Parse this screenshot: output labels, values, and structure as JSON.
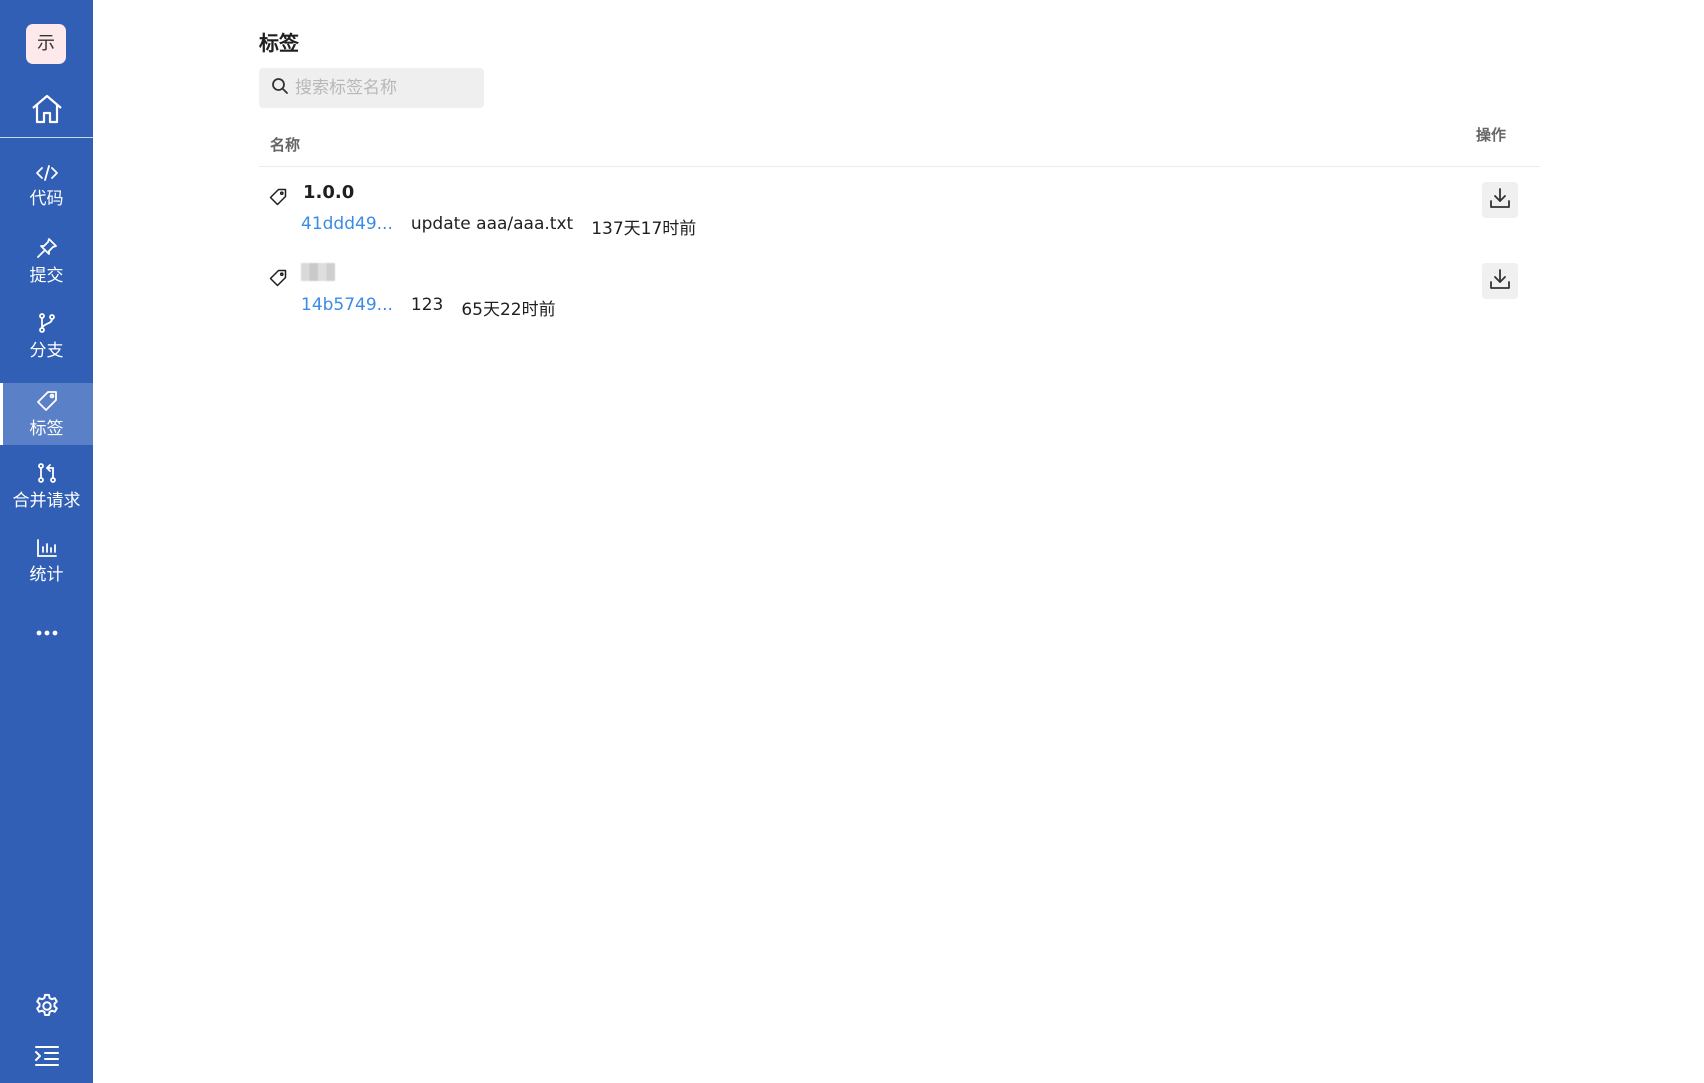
{
  "sidebar": {
    "avatar_text": "示",
    "home_icon": "home-icon",
    "items": [
      {
        "label": "代码",
        "icon": "code-icon",
        "active": false
      },
      {
        "label": "提交",
        "icon": "pin-icon",
        "active": false
      },
      {
        "label": "分支",
        "icon": "branch-icon",
        "active": false
      },
      {
        "label": "标签",
        "icon": "tag-icon",
        "active": true
      },
      {
        "label": "合并请求",
        "icon": "merge-request-icon",
        "active": false
      },
      {
        "label": "统计",
        "icon": "bar-chart-icon",
        "active": false
      }
    ],
    "more_icon": "more-icon",
    "settings_icon": "gear-icon",
    "collapse_icon": "collapse-menu-icon"
  },
  "page": {
    "title": "标签",
    "search": {
      "placeholder": "搜索标签名称",
      "value": ""
    },
    "table": {
      "columns": {
        "name": "名称",
        "actions": "操作"
      },
      "rows": [
        {
          "name": "1.0.0",
          "name_blurred": false,
          "commit": "41ddd49...",
          "message": "update aaa/aaa.txt",
          "time": "137天17时前"
        },
        {
          "name": "",
          "name_blurred": true,
          "commit": "14b5749...",
          "message": "123",
          "time": "65天22时前"
        }
      ]
    }
  },
  "colors": {
    "sidebar_bg": "#315fb5",
    "sidebar_active_bg": "#5a80c7",
    "link": "#3a8be6",
    "avatar_bg": "#fde8ec"
  }
}
